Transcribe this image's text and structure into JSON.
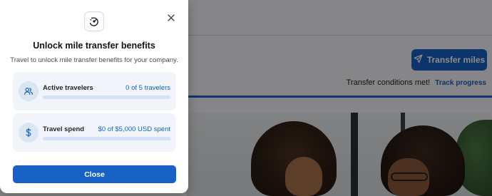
{
  "background": {
    "transfer_button_label": "Transfer miles",
    "transfer_button_icon": "send-icon",
    "conditions_text": "Transfer conditions met!",
    "track_progress_link": "Track progress",
    "colors": {
      "accent": "#1761c4"
    }
  },
  "modal": {
    "top_icon": "gauge-icon",
    "close_icon": "close-icon",
    "title": "Unlock mile transfer benefits",
    "subtitle": "Travel to unlock mile transfer benefits for your company.",
    "cards": [
      {
        "icon": "users-icon",
        "label": "Active travelers",
        "value": "0 of 5 travelers",
        "progress": 0
      },
      {
        "icon": "dollar-icon",
        "label": "Travel spend",
        "value": "$0 of $5,000 USD spent",
        "progress": 0
      }
    ],
    "close_button_label": "Close"
  }
}
